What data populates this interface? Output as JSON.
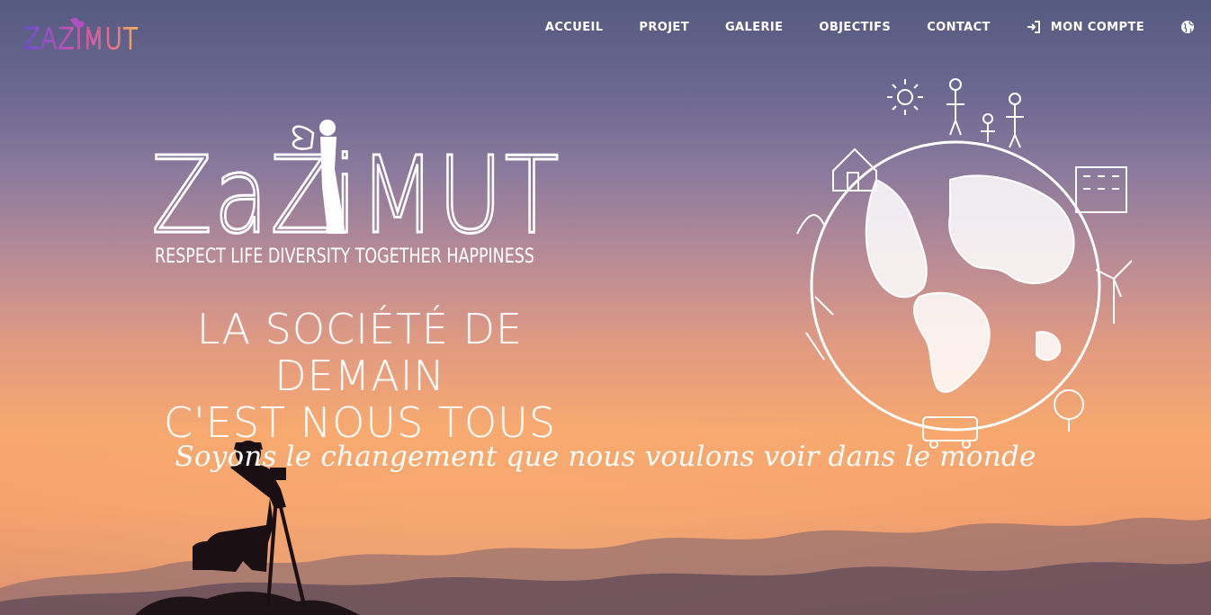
{
  "brand": {
    "small_logo_text": "ZAZIMUT",
    "hero_logo_text": "ZaZiMUT",
    "hero_logo_motto": "RESPECT LIFE DIVERSITY TOGETHER HAPPINESS"
  },
  "nav": {
    "items": [
      {
        "label": "ACCUEIL"
      },
      {
        "label": "PROJET"
      },
      {
        "label": "GALERIE"
      },
      {
        "label": "OBJECTIFS"
      },
      {
        "label": "CONTACT"
      },
      {
        "label": "MON COMPTE",
        "icon": "sign-in-icon"
      }
    ],
    "language_icon": "globe-icon"
  },
  "hero": {
    "headline_line1": "LA SOCIÉTÉ DE DEMAIN",
    "headline_line2": "C'EST NOUS TOUS",
    "tagline": "Soyons le changement que nous voulons voir dans le monde"
  },
  "colors": {
    "sky_top": "#555a80",
    "sky_mid": "#b88b96",
    "sky_bottom": "#f7a86f",
    "nav_text": "#ffffff",
    "logo_gradient": [
      "#6d4bd6",
      "#c154b8",
      "#f06b8a",
      "#f8b55a"
    ]
  }
}
